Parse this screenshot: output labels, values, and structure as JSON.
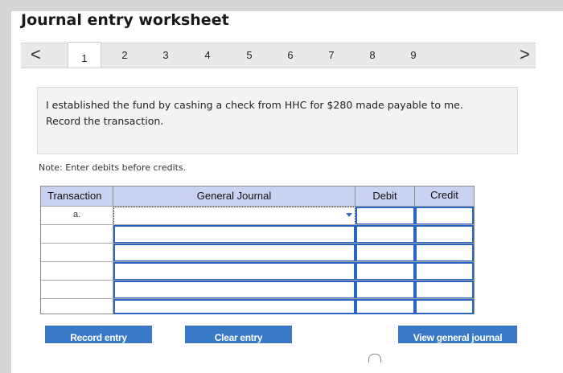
{
  "title": "Journal entry worksheet",
  "tabs": {
    "prev": "<",
    "next": ">",
    "items": [
      "1",
      "2",
      "3",
      "4",
      "5",
      "6",
      "7",
      "8",
      "9"
    ],
    "active": "1"
  },
  "question": "I established the fund by cashing a check from HHC for $280 made payable to me. Record the transaction.",
  "note": "Note: Enter debits before credits.",
  "table": {
    "headers": {
      "transaction": "Transaction",
      "journal": "General Journal",
      "debit": "Debit",
      "credit": "Credit"
    },
    "rows": [
      {
        "transaction": "a.",
        "account": "",
        "debit": "",
        "credit": ""
      },
      {
        "transaction": "",
        "account": "",
        "debit": "",
        "credit": ""
      },
      {
        "transaction": "",
        "account": "",
        "debit": "",
        "credit": ""
      },
      {
        "transaction": "",
        "account": "",
        "debit": "",
        "credit": ""
      },
      {
        "transaction": "",
        "account": "",
        "debit": "",
        "credit": ""
      },
      {
        "transaction": "",
        "account": "",
        "debit": "",
        "credit": ""
      }
    ]
  },
  "buttons": {
    "record": "Record entry",
    "clear": "Clear entry",
    "view": "View general journal"
  },
  "colors": {
    "button": "#3a79c6",
    "header": "#cad2f2",
    "cell_border": "#2a63c4"
  }
}
